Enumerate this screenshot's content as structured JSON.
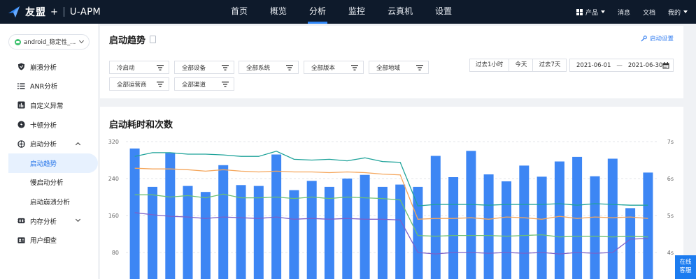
{
  "header": {
    "brand": "友盟",
    "brand_plus": "+",
    "product": "U-APM",
    "nav": [
      "首页",
      "概览",
      "分析",
      "监控",
      "云真机",
      "设置"
    ],
    "active_nav": "分析",
    "right": {
      "products": "产品",
      "messages": "消息",
      "docs": "文档",
      "mine": "我的"
    }
  },
  "sidebar": {
    "app_select": "android_稳定性_...",
    "items": [
      {
        "label": "崩溃分析",
        "icon": "shield-icon"
      },
      {
        "label": "ANR分析",
        "icon": "list-icon"
      },
      {
        "label": "自定义异常",
        "icon": "bar-chart-icon"
      },
      {
        "label": "卡顿分析",
        "icon": "jam-icon"
      },
      {
        "label": "启动分析",
        "icon": "startup-icon"
      },
      {
        "label": "启动趋势"
      },
      {
        "label": "慢启动分析"
      },
      {
        "label": "启动崩溃分析"
      },
      {
        "label": "内存分析",
        "icon": "memory-icon"
      },
      {
        "label": "用户细查",
        "icon": "user-icon"
      }
    ],
    "selected": "启动趋势"
  },
  "filters": {
    "title": "启动趋势",
    "settings_label": "启动设置",
    "dropdowns": [
      "冷启动",
      "全部设备",
      "全部系统",
      "全部版本",
      "全部地域",
      "全部运营商",
      "全部渠道"
    ],
    "ranges": [
      "过去1小时",
      "今天",
      "过去7天"
    ],
    "date_start": "2021-06-01",
    "date_sep": "—",
    "date_end": "2021-06-30"
  },
  "chart_data": {
    "type": "bar",
    "title": "启动耗时和次数",
    "left_ticks": [
      "320",
      "240",
      "160",
      "80"
    ],
    "right_ticks": [
      "7s",
      "6s",
      "5s",
      "4s"
    ],
    "ylim_left": [
      0,
      320
    ],
    "ylim_right": [
      3,
      7
    ],
    "colors": {
      "bars": "#3d86f4",
      "teal": "#1fa39a",
      "orange": "#f5a65b",
      "green": "#6cc072",
      "purple": "#7b61c9"
    },
    "bars": [
      305,
      222,
      295,
      224,
      211,
      269,
      226,
      224,
      292,
      215,
      235,
      222,
      240,
      248,
      222,
      227,
      222,
      289,
      243,
      300,
      249,
      234,
      268,
      244,
      277,
      287,
      245,
      283,
      176,
      253
    ],
    "series": [
      {
        "color": "teal",
        "values": [
          6.6,
          6.7,
          6.7,
          6.66,
          6.66,
          6.64,
          6.6,
          6.6,
          6.74,
          6.52,
          6.5,
          6.52,
          6.48,
          6.56,
          6.46,
          6.44,
          5.26,
          5.3,
          5.3,
          5.3,
          5.28,
          5.3,
          5.3,
          5.3,
          5.32,
          5.28,
          5.32,
          5.3,
          5.28,
          5.28
        ]
      },
      {
        "color": "orange",
        "values": [
          6.28,
          6.26,
          6.26,
          6.24,
          6.2,
          6.24,
          6.2,
          6.18,
          6.2,
          6.18,
          6.18,
          6.16,
          6.18,
          6.16,
          6.12,
          6.1,
          4.9,
          4.92,
          4.92,
          4.94,
          4.9,
          4.96,
          4.94,
          4.9,
          4.98,
          4.92,
          4.96,
          4.94,
          4.96,
          4.92
        ]
      },
      {
        "color": "green",
        "values": [
          5.56,
          5.56,
          5.5,
          5.54,
          5.48,
          5.58,
          5.48,
          5.48,
          5.5,
          5.46,
          5.5,
          5.46,
          5.5,
          5.48,
          5.46,
          5.42,
          4.46,
          4.44,
          4.46,
          4.46,
          4.46,
          4.44,
          4.46,
          4.48,
          4.42,
          4.44,
          4.44,
          4.42,
          4.44,
          4.42
        ]
      },
      {
        "color": "purple",
        "values": [
          5.08,
          5.02,
          4.98,
          4.96,
          4.92,
          4.96,
          4.94,
          4.92,
          4.96,
          4.9,
          4.92,
          4.9,
          4.92,
          4.9,
          4.9,
          4.88,
          4.0,
          3.96,
          4.0,
          4.0,
          3.98,
          4.0,
          3.98,
          4.0,
          3.96,
          4.0,
          3.98,
          4.0,
          4.36,
          4.38
        ]
      }
    ]
  },
  "service": {
    "line1": "在线",
    "line2": "客服"
  }
}
